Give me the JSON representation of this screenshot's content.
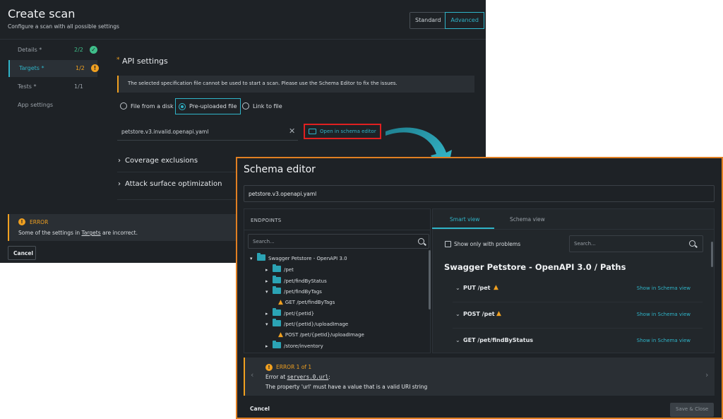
{
  "create_scan": {
    "title": "Create scan",
    "subtitle": "Configure a scan with all possible settings",
    "modes": [
      "Standard",
      "Advanced"
    ],
    "steps": [
      {
        "label": "Details *",
        "count": "2/2"
      },
      {
        "label": "Targets *",
        "count": "1/2"
      },
      {
        "label": "Tests *",
        "count": "1/1"
      },
      {
        "label": "App settings",
        "count": ""
      }
    ],
    "section_title": "API settings",
    "section_marker": "*",
    "info_message": "The selected specification file cannot be used to start a scan. Please use the Schema Editor to fix the issues.",
    "source_options": [
      "File from a disk",
      "Pre-uploaded file",
      "Link to file"
    ],
    "file_name": "petstore.v3.invalid.openapi.yaml",
    "open_editor_label": "Open in schema editor",
    "collapsibles": [
      "Coverage exclusions",
      "Attack surface optimization"
    ],
    "error": {
      "title": "ERROR",
      "message_prefix": "Some of the settings in ",
      "message_link": "Targets",
      "message_suffix": " are incorrect."
    },
    "cancel_label": "Cancel"
  },
  "schema_editor": {
    "title": "Schema editor",
    "file_name": "petstore.v3.openapi.yaml",
    "endpoints_header": "ENDPOINTS",
    "search_placeholder": "Search...",
    "tree": [
      {
        "label": "Swagger Petstore - OpenAPI 3.0",
        "kind": "root"
      },
      {
        "label": "/pet",
        "kind": "folder"
      },
      {
        "label": "/pet/findByStatus",
        "kind": "folder"
      },
      {
        "label": "/pet/findByTags",
        "kind": "folder"
      },
      {
        "label": "GET /pet/findByTags",
        "kind": "warning"
      },
      {
        "label": "/pet/{petId}",
        "kind": "folder"
      },
      {
        "label": "/pet/{petId}/uploadImage",
        "kind": "folder"
      },
      {
        "label": "POST /pet/{petId}/uploadImage",
        "kind": "warning"
      },
      {
        "label": "/store/inventory",
        "kind": "folder"
      }
    ],
    "tabs": [
      "Smart view",
      "Schema view"
    ],
    "only_problems_label": "Show only with problems",
    "right_search_placeholder": "Search...",
    "paths_title": "Swagger Petstore - OpenAPI 3.0 / Paths",
    "paths": [
      {
        "label": "PUT /pet",
        "link": "Show in Schema view"
      },
      {
        "label": "POST /pet",
        "link": "Show in Schema view"
      },
      {
        "label": "GET /pet/findByStatus",
        "link": "Show in Schema view"
      }
    ],
    "error": {
      "title": "ERROR 1 of 1",
      "location_prefix": "Error at ",
      "location_code": "servers.0.url",
      "location_suffix": ":",
      "message": "The property 'url' must have a value that is a valid URI string"
    },
    "cancel_label": "Cancel",
    "save_label": "Save & Close"
  },
  "colors": {
    "accent": "#2fb4c8",
    "warning": "#f0a020",
    "highlight_box": "#e02020",
    "editor_border": "#e07f22"
  }
}
